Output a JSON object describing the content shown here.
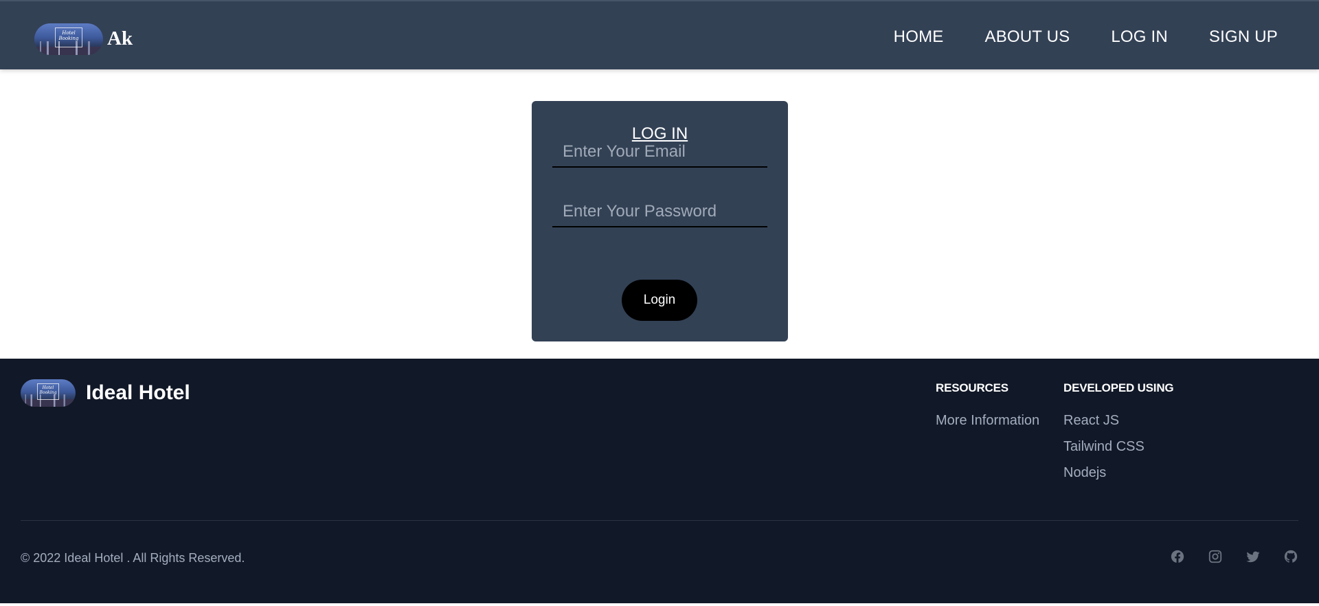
{
  "navbar": {
    "brand": "Ak",
    "logo_text_line1": "Hotel",
    "logo_text_line2": "Booking",
    "links": [
      {
        "label": "HOME"
      },
      {
        "label": "ABOUT US"
      },
      {
        "label": "LOG IN"
      },
      {
        "label": "SIGN UP"
      }
    ]
  },
  "login": {
    "title": "LOG IN",
    "email_placeholder": "Enter Your Email",
    "password_placeholder": "Enter Your Password",
    "button_label": "Login"
  },
  "footer": {
    "brand": "Ideal Hotel",
    "logo_text_line1": "Hotel",
    "logo_text_line2": "Booking",
    "columns": [
      {
        "heading": "RESOURCES",
        "links": [
          "More Information"
        ]
      },
      {
        "heading": "DEVELOPED USING",
        "links": [
          "React JS",
          "Tailwind CSS",
          "Nodejs"
        ]
      }
    ],
    "copyright": "© 2022 Ideal Hotel . All Rights Reserved.",
    "social_icons": [
      "facebook-icon",
      "instagram-icon",
      "twitter-icon",
      "github-icon"
    ]
  },
  "colors": {
    "navbar_bg": "#334155",
    "card_bg": "#334155",
    "footer_bg": "#111827",
    "button_bg": "#000000",
    "muted_text": "#a3aebf",
    "icon_gray": "#6b7280"
  }
}
